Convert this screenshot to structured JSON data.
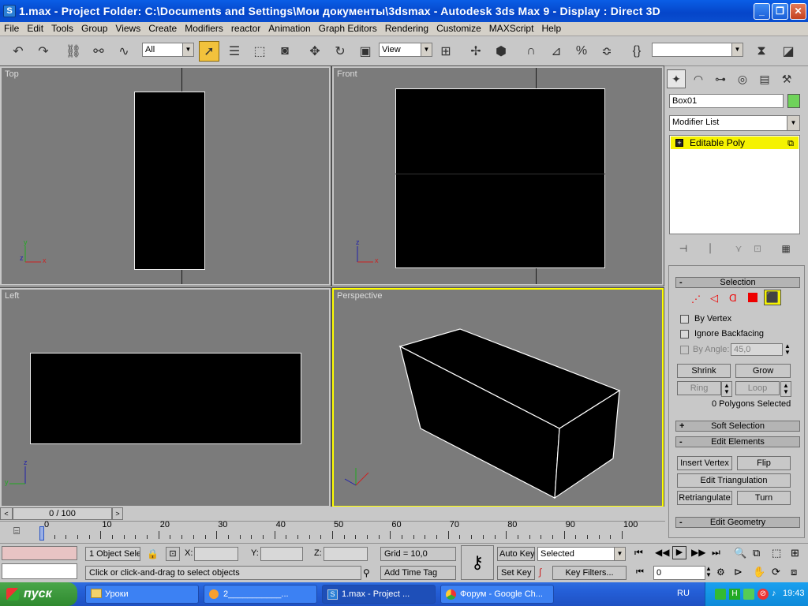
{
  "title": "1.max     - Project Folder: C:\\Documents and Settings\\Мои документы\\3dsmax      - Autodesk 3ds Max 9      - Display : Direct 3D",
  "app_icon": "3ds-max-icon",
  "menu": [
    "File",
    "Edit",
    "Tools",
    "Group",
    "Views",
    "Create",
    "Modifiers",
    "reactor",
    "Animation",
    "Graph Editors",
    "Rendering",
    "Customize",
    "MAXScript",
    "Help"
  ],
  "toolbar": {
    "selection_filter": "All",
    "ref_coord": "View",
    "named_sel": ""
  },
  "viewports": {
    "top": "Top",
    "front": "Front",
    "left": "Left",
    "perspective": "Perspective"
  },
  "axis": {
    "x": "x",
    "y": "y",
    "z": "z"
  },
  "cmd": {
    "object_name": "Box01",
    "object_color": "#6fd35a",
    "modifier_list": "Modifier List",
    "stack_item": "Editable Poly",
    "selection": {
      "title": "Selection",
      "by_vertex": "By Vertex",
      "ignore_backfacing": "Ignore Backfacing",
      "by_angle": "By Angle:",
      "angle_value": "45,0",
      "shrink": "Shrink",
      "grow": "Grow",
      "ring": "Ring",
      "loop": "Loop",
      "info": "0 Polygons Selected"
    },
    "soft_selection": "Soft Selection",
    "edit_elements": {
      "title": "Edit Elements",
      "insert_vertex": "Insert Vertex",
      "flip": "Flip",
      "edit_triangulation": "Edit Triangulation",
      "retriangulate": "Retriangulate",
      "turn": "Turn"
    },
    "edit_geometry": "Edit Geometry"
  },
  "timeline": {
    "frame": "0 / 100",
    "ticks": [
      "0",
      "10",
      "20",
      "30",
      "40",
      "50",
      "60",
      "70",
      "80",
      "90",
      "100"
    ]
  },
  "status": {
    "selected": "1 Object Sele",
    "x_label": "X:",
    "y_label": "Y:",
    "z_label": "Z:",
    "grid": "Grid = 10,0",
    "prompt": "Click or click-and-drag to select objects",
    "add_time_tag": "Add Time Tag",
    "auto_key": "Auto Key",
    "set_key": "Set Key",
    "key_mode": "Selected",
    "key_filters": "Key Filters...",
    "current_frame": "0"
  },
  "taskbar": {
    "start": "пуск",
    "tasks": [
      "Уроки",
      "2___________...",
      "1.max     - Project ...",
      "Форум - Google Ch..."
    ],
    "lang": "RU",
    "clock": "19:43"
  }
}
